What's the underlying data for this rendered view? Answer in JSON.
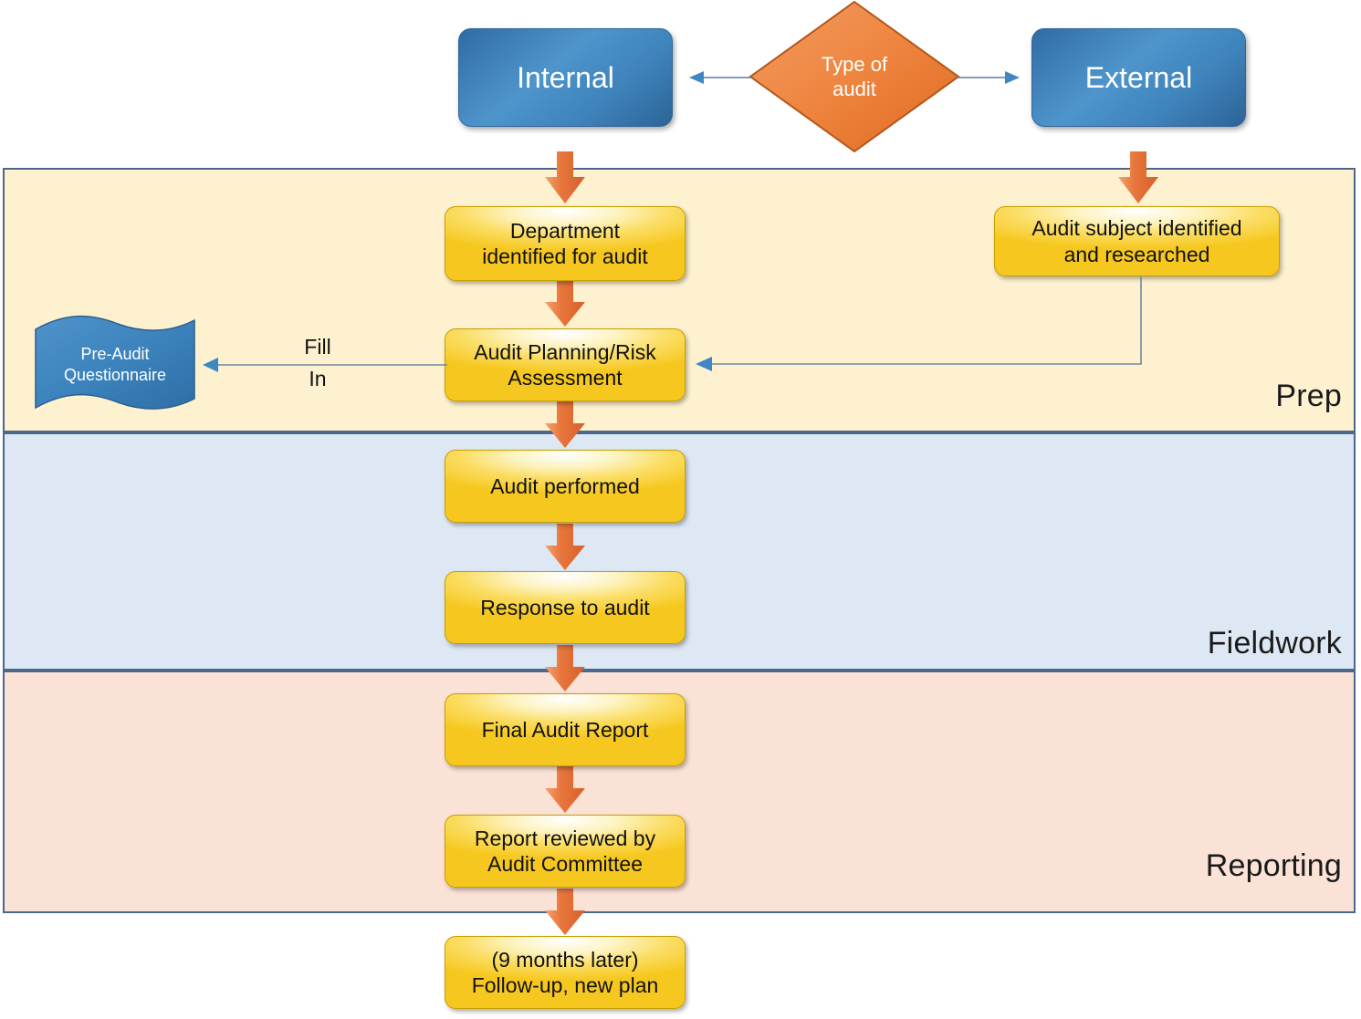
{
  "diagram": {
    "title": "Audit process flowchart",
    "colors": {
      "prep_band": "#fdf1cf",
      "fieldwork_band": "#dde8f4",
      "reporting_band": "#fbe2d6",
      "band_border": "#4a688c",
      "process_box": "#f6c81f",
      "blue_box": "#3e83bb",
      "diamond": "#ed7d31",
      "arrow": "#e2703a",
      "connector_line": "#5b7c9d"
    }
  },
  "decision": {
    "line1": "Type of",
    "line2": "audit"
  },
  "branches": {
    "internal": "Internal",
    "external": "External"
  },
  "bands": [
    {
      "key": "prep",
      "label": "Prep"
    },
    {
      "key": "fieldwork",
      "label": "Fieldwork"
    },
    {
      "key": "reporting",
      "label": "Reporting"
    }
  ],
  "nodes": {
    "department_identified": {
      "line1": "Department",
      "line2": "identified for audit"
    },
    "audit_subject": {
      "line1": "Audit subject identified",
      "line2": "and researched"
    },
    "audit_planning": {
      "line1": "Audit Planning/Risk",
      "line2": "Assessment"
    },
    "pre_audit_questionnaire": {
      "line1": "Pre-Audit",
      "line2": "Questionnaire"
    },
    "audit_performed": {
      "line1": "Audit performed"
    },
    "response_to_audit": {
      "line1": "Response to audit"
    },
    "final_audit_report": {
      "line1": "Final Audit Report"
    },
    "report_reviewed": {
      "line1": "Report reviewed by",
      "line2": "Audit Committee"
    },
    "follow_up": {
      "line1": "(9 months later)",
      "line2": "Follow-up, new plan"
    }
  },
  "edges": {
    "fill_in_top": "Fill",
    "fill_in_bottom": "In"
  }
}
